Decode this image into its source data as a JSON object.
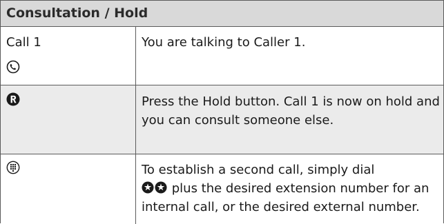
{
  "header": {
    "title": "Consultation / Hold"
  },
  "rows": [
    {
      "left_label": "Call 1",
      "left_icon": "handset-icon",
      "description": "You are talking to Caller 1."
    },
    {
      "left_icon": "r-key-icon",
      "description": "Press the Hold button. Call 1 is now on hold and you can consult someone else."
    },
    {
      "left_icon": "keypad-icon",
      "description_part1": "To establish a second call, simply dial",
      "description_part2": "plus the desired extension number for an internal call, or the desired external number.",
      "inline_icons": [
        "star-key-icon",
        "star-key-icon"
      ]
    }
  ],
  "colors": {
    "header_bg": "#d9d9d9",
    "row_shaded_bg": "#ebebeb",
    "border": "#5a5a5a"
  }
}
